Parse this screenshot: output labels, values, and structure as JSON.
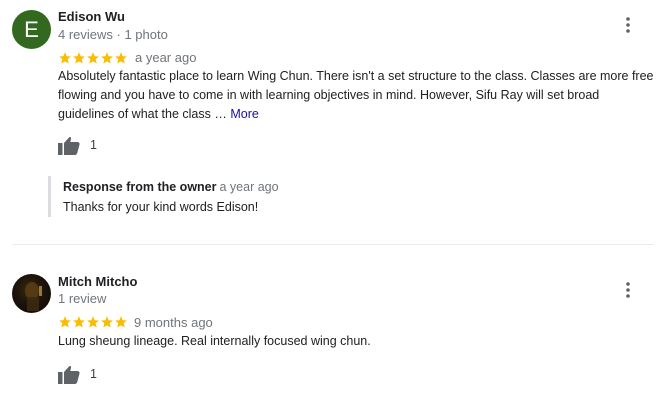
{
  "reviews": [
    {
      "avatar_letter": "E",
      "avatar_color": "#33691e",
      "name": "Edison Wu",
      "meta": "4 reviews · 1 photo",
      "rating": 5,
      "time": "a year ago",
      "text": "Absolutely fantastic place to learn Wing Chun. There isn't a set structure to the class. Classes are more free flowing and you have to come in with learning objectives in mind. However, Sifu Ray will set broad guidelines of what the class",
      "ellipsis": "…",
      "more_label": "More",
      "likes": "1",
      "owner_response": {
        "label": "Response from the owner",
        "time": "a year ago",
        "text": "Thanks for your kind words Edison!"
      }
    },
    {
      "avatar_icon": "profile-photo-icon",
      "name": "Mitch Mitcho",
      "meta": "1 review",
      "rating": 5,
      "time": "9 months ago",
      "text": "Lung sheung lineage. Real internally focused wing chun.",
      "likes": "1"
    }
  ],
  "colors": {
    "star": "#fbbc04",
    "link": "#1a0dab",
    "secondary_text": "#70757a",
    "icon": "#5f6368"
  },
  "icons": {
    "menu": "more-vert-icon",
    "like": "thumb-up-icon",
    "star": "star-icon"
  }
}
